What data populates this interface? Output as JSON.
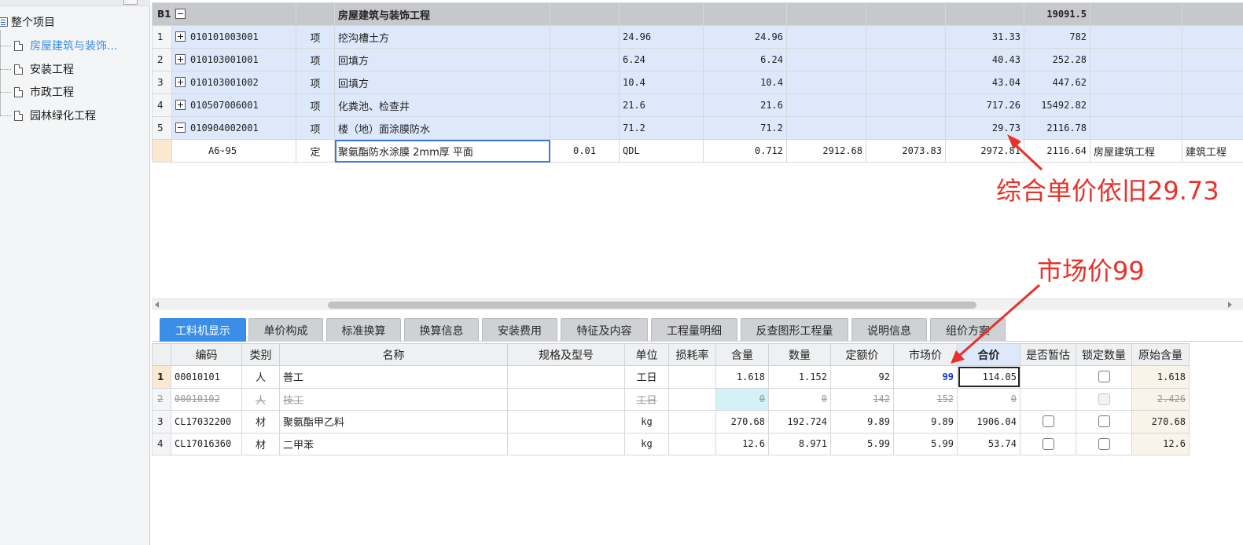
{
  "tree": {
    "root": "整个项目",
    "items": [
      {
        "label": "房屋建筑与装饰..."
      },
      {
        "label": "安装工程"
      },
      {
        "label": "市政工程"
      },
      {
        "label": "园林绿化工程"
      }
    ]
  },
  "upper": {
    "section": {
      "rn": "B1",
      "name": "房屋建筑与装饰工程",
      "total": "19091.5"
    },
    "items": [
      {
        "rn": "1",
        "code": "010101003001",
        "type": "项",
        "name": "挖沟槽土方",
        "qty": "24.96",
        "qty2": "24.96",
        "unit_price": "31.33",
        "total": "782"
      },
      {
        "rn": "2",
        "code": "010103001001",
        "type": "项",
        "name": "回填方",
        "qty": "6.24",
        "qty2": "6.24",
        "unit_price": "40.43",
        "total": "252.28"
      },
      {
        "rn": "3",
        "code": "010103001002",
        "type": "项",
        "name": "回填方",
        "qty": "10.4",
        "qty2": "10.4",
        "unit_price": "43.04",
        "total": "447.62"
      },
      {
        "rn": "4",
        "code": "010507006001",
        "type": "项",
        "name": "化粪池、检查井",
        "qty": "21.6",
        "qty2": "21.6",
        "unit_price": "717.26",
        "total": "15492.82"
      },
      {
        "rn": "5",
        "code": "010904002001",
        "type": "项",
        "name": "楼（地）面涂膜防水",
        "qty": "71.2",
        "qty2": "71.2",
        "unit_price": "29.73",
        "total": "2116.78"
      }
    ],
    "quota": {
      "code": "A6-95",
      "type": "定",
      "name": "聚氨酯防水涂膜 2mm厚 平面",
      "coef": "0.01",
      "expr": "QDL",
      "qty": "0.712",
      "v1": "2912.68",
      "v2": "2073.83",
      "v3": "2972.81",
      "total": "2116.64",
      "spec": "房屋建筑工程",
      "major": "建筑工程"
    }
  },
  "tabs": [
    "工料机显示",
    "单价构成",
    "标准换算",
    "换算信息",
    "安装费用",
    "特征及内容",
    "工程量明细",
    "反查图形工程量",
    "说明信息",
    "组价方案"
  ],
  "lower": {
    "headers": [
      "编码",
      "类别",
      "名称",
      "规格及型号",
      "单位",
      "损耗率",
      "含量",
      "数量",
      "定额价",
      "市场价",
      "合价",
      "是否暂估",
      "锁定数量",
      "原始含量"
    ],
    "rows": [
      {
        "rn": "1",
        "code": "00010101",
        "cat": "人",
        "name": "普工",
        "spec": "",
        "unit": "工日",
        "loss": "",
        "content": "1.618",
        "qty": "1.152",
        "quota_price": "92",
        "market": "99",
        "total": "114.05",
        "orig": "1.618"
      },
      {
        "rn": "2",
        "code": "00010102",
        "cat": "人",
        "name": "技工",
        "spec": "",
        "unit": "工日",
        "loss": "",
        "content": "0",
        "qty": "0",
        "quota_price": "142",
        "market": "152",
        "total": "0",
        "orig": "2.426"
      },
      {
        "rn": "3",
        "code": "CL17032200",
        "cat": "材",
        "name": "聚氨酯甲乙料",
        "spec": "",
        "unit": "kg",
        "loss": "",
        "content": "270.68",
        "qty": "192.724",
        "quota_price": "9.89",
        "market": "9.89",
        "total": "1906.04",
        "orig": "270.68"
      },
      {
        "rn": "4",
        "code": "CL17016360",
        "cat": "材",
        "name": "二甲苯",
        "spec": "",
        "unit": "kg",
        "loss": "",
        "content": "12.6",
        "qty": "8.971",
        "quota_price": "5.99",
        "market": "5.99",
        "total": "53.74",
        "orig": "12.6"
      }
    ]
  },
  "annotations": {
    "unit_price_note": "综合单价依旧29.73",
    "market_price_note": "市场价99",
    "color": "#e8312a"
  }
}
